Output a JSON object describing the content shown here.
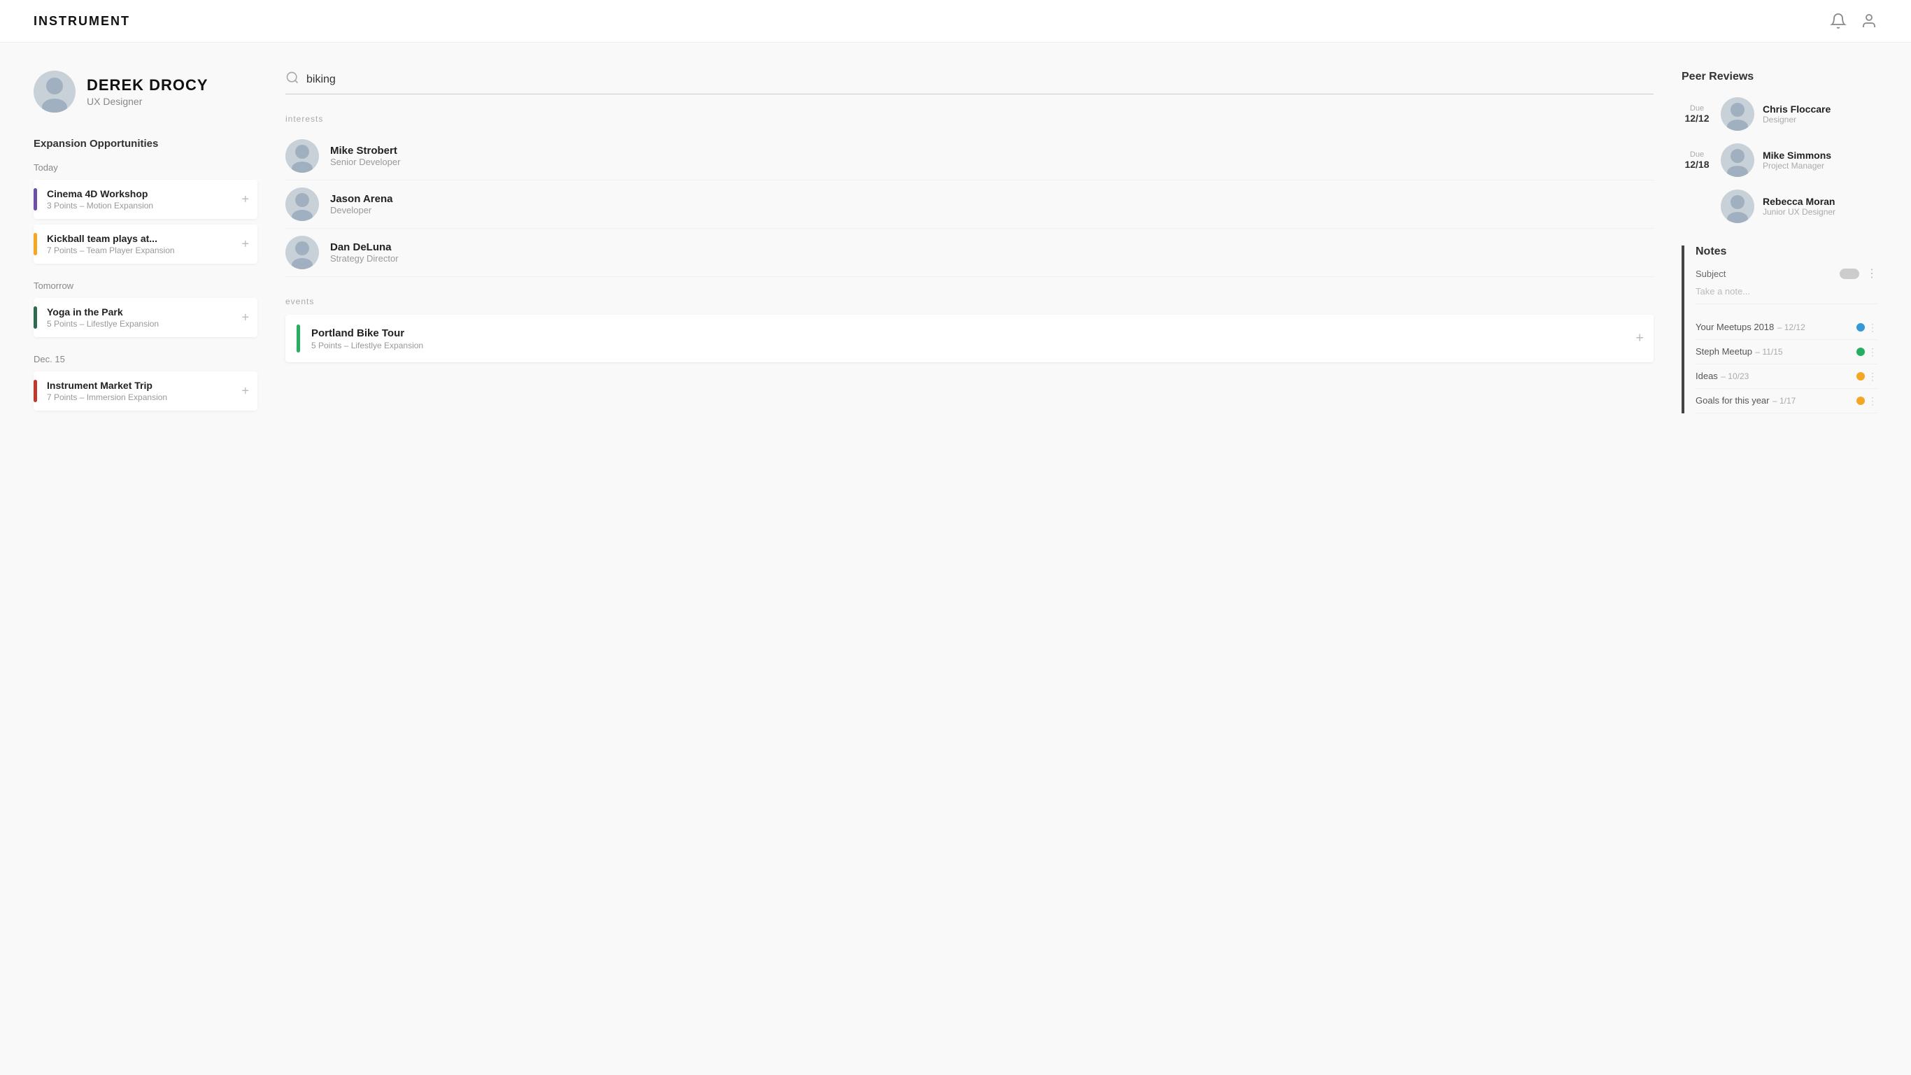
{
  "header": {
    "logo": "INSTRUMENT",
    "notification_icon": "bell",
    "user_icon": "person"
  },
  "profile": {
    "name": "DEREK DROCY",
    "role": "UX Designer"
  },
  "expansion": {
    "section_title": "Expansion Opportunities",
    "groups": [
      {
        "date_label": "Today",
        "events": [
          {
            "title": "Cinema 4D Workshop",
            "subtitle": "3 Points – Motion Expansion",
            "bar_color": "bar-purple"
          },
          {
            "title": "Kickball team plays at...",
            "subtitle": "7 Points – Team Player Expansion",
            "bar_color": "bar-orange"
          }
        ]
      },
      {
        "date_label": "Tomorrow",
        "events": [
          {
            "title": "Yoga in the Park",
            "subtitle": "5 Points – Lifestlye Expansion",
            "bar_color": "bar-green-dark"
          }
        ]
      },
      {
        "date_label": "Dec. 15",
        "events": [
          {
            "title": "Instrument Market Trip",
            "subtitle": "7 Points – Immersion Expansion",
            "bar_color": "bar-red"
          }
        ]
      }
    ]
  },
  "search": {
    "placeholder": "biking",
    "value": "biking"
  },
  "results": {
    "interests_label": "interests",
    "people": [
      {
        "name": "Mike Strobert",
        "role": "Senior Developer"
      },
      {
        "name": "Jason Arena",
        "role": "Developer"
      },
      {
        "name": "Dan DeLuna",
        "role": "Strategy Director"
      }
    ],
    "events_label": "events",
    "events": [
      {
        "title": "Portland Bike Tour",
        "subtitle": "5 Points – Lifestlye Expansion",
        "bar_color": "bar-teal"
      }
    ]
  },
  "peer_reviews": {
    "section_title": "Peer Reviews",
    "items": [
      {
        "due_label": "Due",
        "due_date": "12/12",
        "name": "Chris Floccare",
        "role": "Designer"
      },
      {
        "due_label": "Due",
        "due_date": "12/18",
        "name": "Mike Simmons",
        "role": "Project Manager"
      },
      {
        "due_label": "",
        "due_date": "",
        "name": "Rebecca Moran",
        "role": "Junior UX Designer"
      }
    ]
  },
  "notes": {
    "section_title": "Notes",
    "subject_label": "Subject",
    "placeholder": "Take a note...",
    "items": [
      {
        "text": "Your Meetups 2018",
        "date": "12/12",
        "dot_color": "dot-blue"
      },
      {
        "text": "Steph Meetup",
        "date": "11/15",
        "dot_color": "dot-green"
      },
      {
        "text": "Ideas",
        "date": "10/23",
        "dot_color": "dot-orange"
      },
      {
        "text": "Goals for this year",
        "date": "1/17",
        "dot_color": "dot-orange"
      }
    ]
  }
}
